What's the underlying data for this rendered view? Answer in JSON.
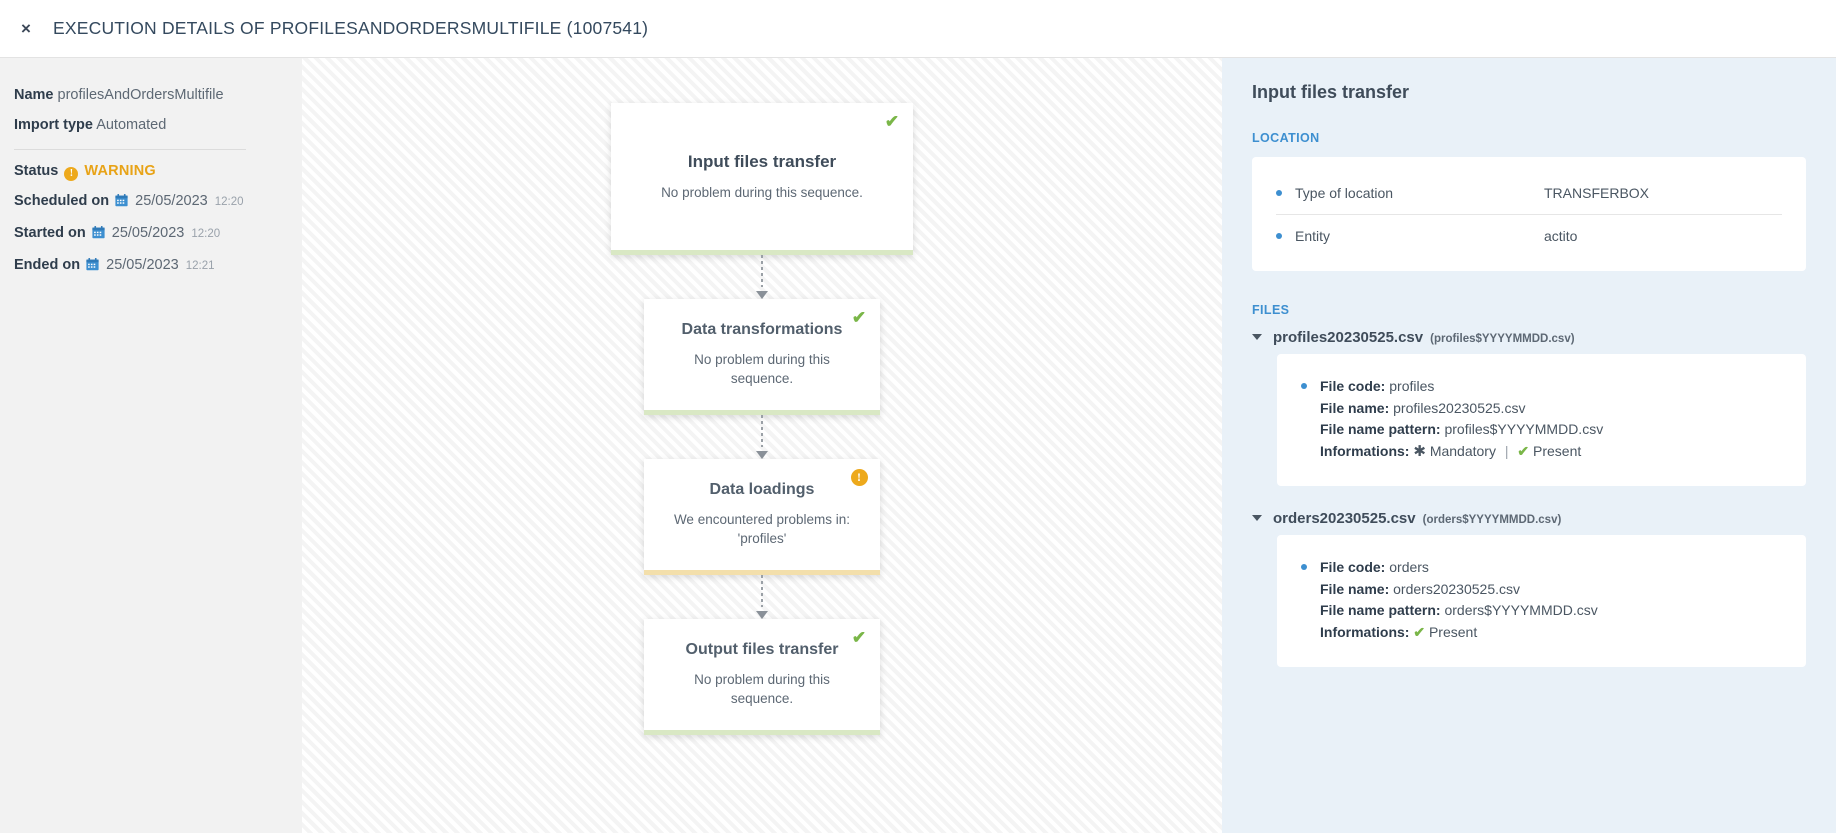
{
  "header": {
    "close_icon": "close-icon",
    "title": "EXECUTION DETAILS OF PROFILESANDORDERSMULTIFILE (1007541)"
  },
  "sidebar": {
    "name_label": "Name",
    "name_value": "profilesAndOrdersMultifile",
    "import_type_label": "Import type",
    "import_type_value": "Automated",
    "status_label": "Status",
    "status_value": "WARNING",
    "status_icon": "warning-circle-icon",
    "status_color": "#e8a317",
    "scheduled_label": "Scheduled on",
    "scheduled_date": "25/05/2023",
    "scheduled_time": "12:20",
    "started_label": "Started on",
    "started_date": "25/05/2023",
    "started_time": "12:20",
    "ended_label": "Ended on",
    "ended_date": "25/05/2023",
    "ended_time": "12:21",
    "calendar_icon": "calendar-icon"
  },
  "flow": {
    "nodes": [
      {
        "title": "Input files transfer",
        "desc": "No problem during this sequence.",
        "state": "ok",
        "badge_icon": "check-icon",
        "accent": "#d9e8c4"
      },
      {
        "title": "Data transformations",
        "desc": "No problem during this sequence.",
        "state": "ok",
        "badge_icon": "check-icon",
        "accent": "#d9e8c4"
      },
      {
        "title": "Data loadings",
        "desc": "We encountered problems in: 'profiles'",
        "state": "warning",
        "badge_icon": "warning-circle-icon",
        "accent": "#f3dfab"
      },
      {
        "title": "Output files transfer",
        "desc": "No problem during this sequence.",
        "state": "ok",
        "badge_icon": "check-icon",
        "accent": "#d9e8c4"
      }
    ]
  },
  "detail": {
    "title": "Input files transfer",
    "location_section_label": "LOCATION",
    "location_rows": [
      {
        "key": "Type of location",
        "value": "TRANSFERBOX"
      },
      {
        "key": "Entity",
        "value": "actito"
      }
    ],
    "files_section_label": "FILES",
    "files": [
      {
        "name": "profiles20230525.csv",
        "pattern": "(profiles$YYYYMMDD.csv)",
        "file_code_label": "File code:",
        "file_code": "profiles",
        "file_name_label": "File name:",
        "file_name": "profiles20230525.csv",
        "file_pattern_label": "File name pattern:",
        "file_pattern": "profiles$YYYYMMDD.csv",
        "informations_label": "Informations:",
        "mandatory_icon": "asterisk-icon",
        "mandatory_text": "Mandatory",
        "separator": "|",
        "present_icon": "check-icon",
        "present_text": "Present",
        "has_mandatory": true
      },
      {
        "name": "orders20230525.csv",
        "pattern": "(orders$YYYYMMDD.csv)",
        "file_code_label": "File code:",
        "file_code": "orders",
        "file_name_label": "File name:",
        "file_name": "orders20230525.csv",
        "file_pattern_label": "File name pattern:",
        "file_pattern": "orders$YYYYMMDD.csv",
        "informations_label": "Informations:",
        "mandatory_icon": "",
        "mandatory_text": "",
        "separator": "",
        "present_icon": "check-icon",
        "present_text": "Present",
        "has_mandatory": false
      }
    ]
  },
  "glyphs": {
    "close": "×",
    "check": "✔",
    "exclam": "!",
    "asterisk": "✱"
  }
}
